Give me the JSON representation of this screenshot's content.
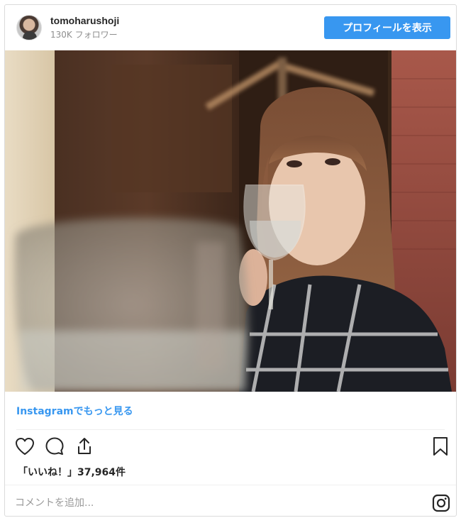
{
  "header": {
    "username": "tomoharushoji",
    "followers": "130K フォロワー",
    "profile_button_label": "プロフィールを表示"
  },
  "post": {
    "view_more_label": "Instagramでもっと見る",
    "likes_text": "「いいね！」37,964件"
  },
  "actions": {
    "icons": [
      "heart-icon",
      "comment-icon",
      "share-icon",
      "bookmark-icon"
    ]
  },
  "comment": {
    "placeholder": "コメントを追加..."
  },
  "footer": {
    "brand_icon": "instagram-icon"
  },
  "colors": {
    "accent": "#3897f0",
    "border": "#dbdbdb",
    "text": "#262626",
    "muted": "#8e8e8e"
  }
}
